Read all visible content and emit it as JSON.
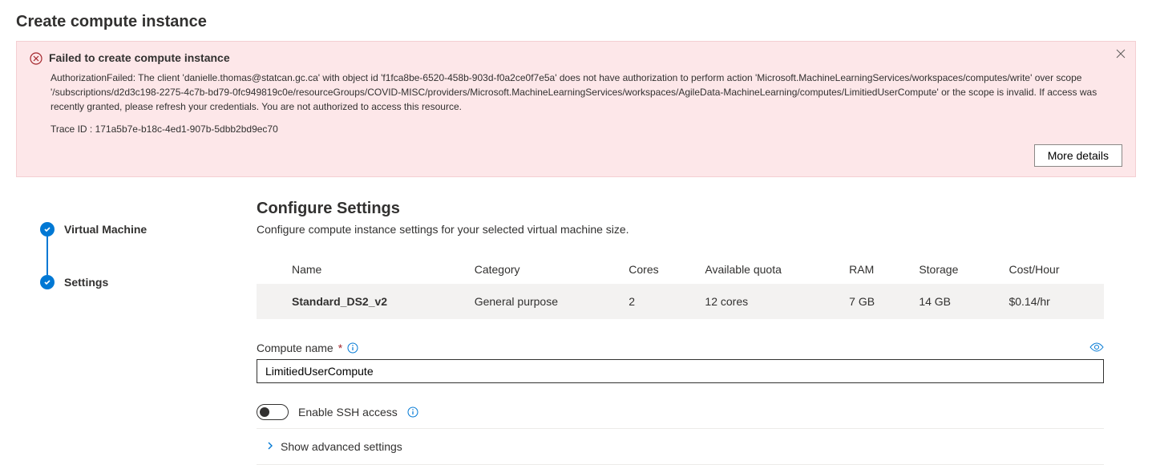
{
  "page_title": "Create compute instance",
  "alert": {
    "title": "Failed to create compute instance",
    "body": "AuthorizationFailed: The client 'danielle.thomas@statcan.gc.ca' with object id 'f1fca8be-6520-458b-903d-f0a2ce0f7e5a' does not have authorization to perform action 'Microsoft.MachineLearningServices/workspaces/computes/write' over scope '/subscriptions/d2d3c198-2275-4c7b-bd79-0fc949819c0e/resourceGroups/COVID-MISC/providers/Microsoft.MachineLearningServices/workspaces/AgileData-MachineLearning/computes/LimitiedUserCompute' or the scope is invalid. If access was recently granted, please refresh your credentials. You are not authorized to access this resource.",
    "trace_label": "Trace ID :",
    "trace_id": "171a5b7e-b18c-4ed1-907b-5dbb2bd9ec70",
    "more_details": "More details"
  },
  "stepper": {
    "step1": "Virtual Machine",
    "step2": "Settings"
  },
  "main": {
    "section_title": "Configure Settings",
    "section_desc": "Configure compute instance settings for your selected virtual machine size.",
    "table": {
      "headers": {
        "name": "Name",
        "category": "Category",
        "cores": "Cores",
        "quota": "Available quota",
        "ram": "RAM",
        "storage": "Storage",
        "cost": "Cost/Hour"
      },
      "row": {
        "name": "Standard_DS2_v2",
        "category": "General purpose",
        "cores": "2",
        "quota": "12 cores",
        "ram": "7 GB",
        "storage": "14 GB",
        "cost": "$0.14/hr"
      }
    },
    "compute_name_label": "Compute name",
    "compute_name_value": "LimitiedUserCompute",
    "ssh_label": "Enable SSH access",
    "advanced_label": "Show advanced settings"
  }
}
